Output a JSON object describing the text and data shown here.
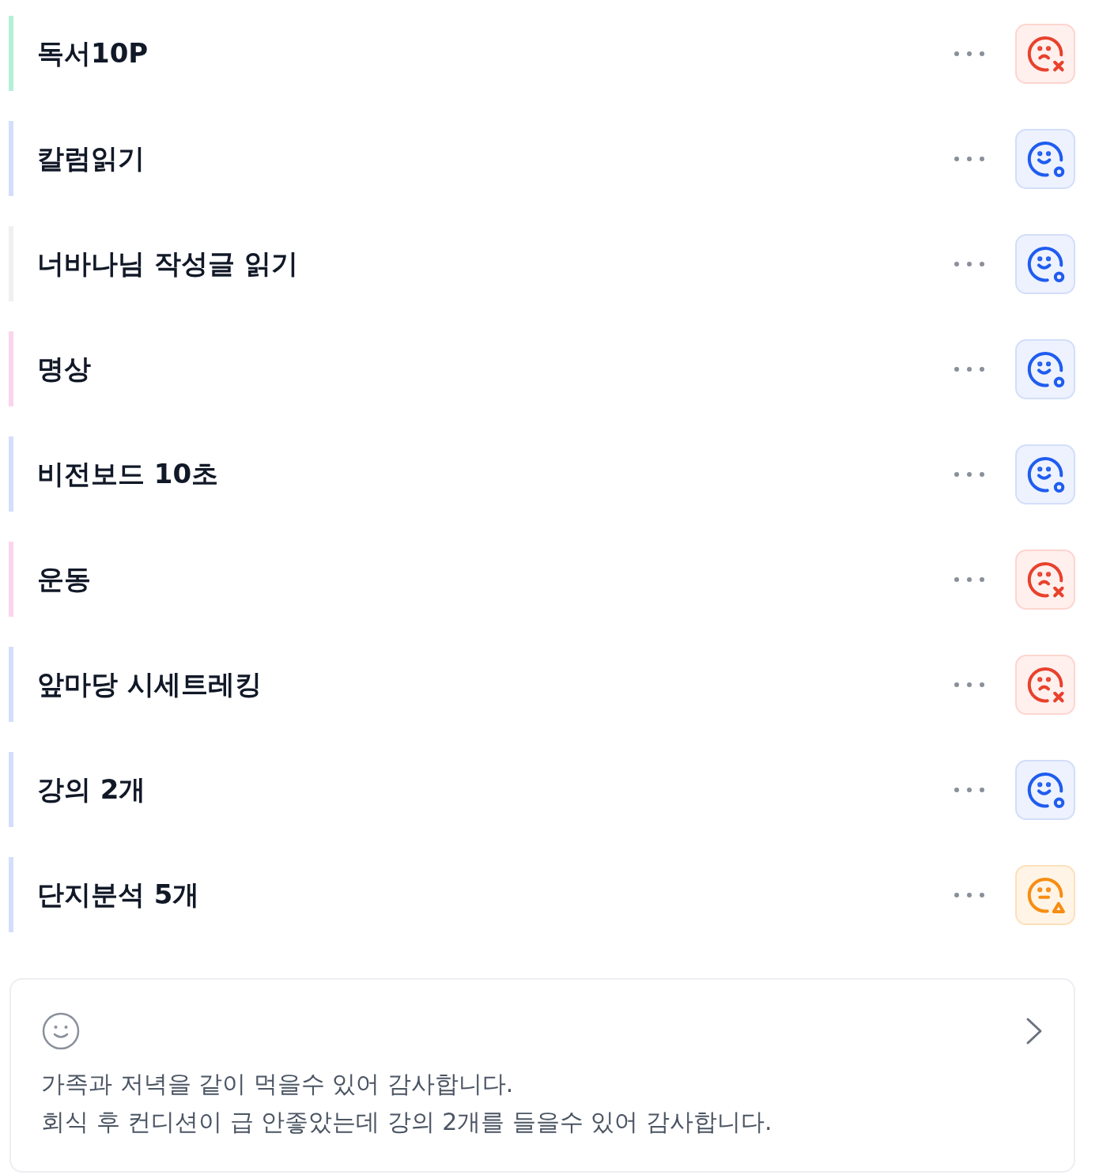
{
  "habits": [
    {
      "title": "독서10P",
      "color": "#b4f0d8",
      "kind": "fail"
    },
    {
      "title": "칼럼읽기",
      "color": "#d4defc",
      "kind": "success"
    },
    {
      "title": "너바나님 작성글 읽기",
      "color": "#f0f0f0",
      "kind": "success"
    },
    {
      "title": "명상",
      "color": "#fcd4ec",
      "kind": "success"
    },
    {
      "title": "비전보드 10초",
      "color": "#d4defc",
      "kind": "success"
    },
    {
      "title": "운동",
      "color": "#fcd4ec",
      "kind": "fail"
    },
    {
      "title": "앞마당 시세트레킹",
      "color": "#d4defc",
      "kind": "fail"
    },
    {
      "title": "강의 2개",
      "color": "#d4defc",
      "kind": "success"
    },
    {
      "title": "단지분석 5개",
      "color": "#d4defc",
      "kind": "partial"
    }
  ],
  "note": {
    "lines": [
      "가족과 저녁을 같이 먹을수 있어 감사합니다.",
      "회식 후 컨디션이 급 안좋았는데 강의 2개를 들을수 있어 감사합니다."
    ]
  }
}
